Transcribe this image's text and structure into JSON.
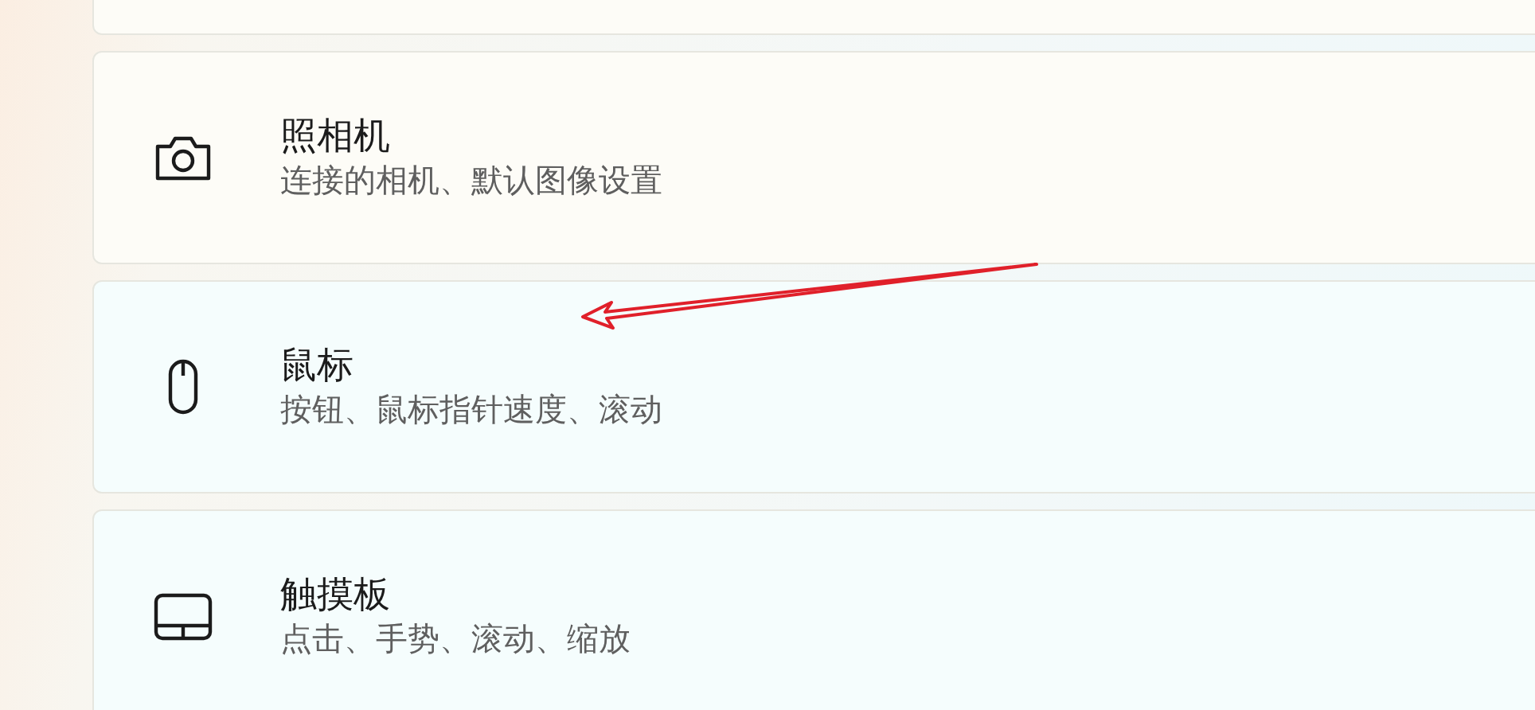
{
  "settings_items": [
    {
      "kind": "camera",
      "title": "照相机",
      "description": "连接的相机、默认图像设置"
    },
    {
      "kind": "mouse",
      "title": "鼠标",
      "description": "按钮、鼠标指针速度、滚动"
    },
    {
      "kind": "touchpad",
      "title": "触摸板",
      "description": "点击、手势、滚动、缩放"
    }
  ]
}
